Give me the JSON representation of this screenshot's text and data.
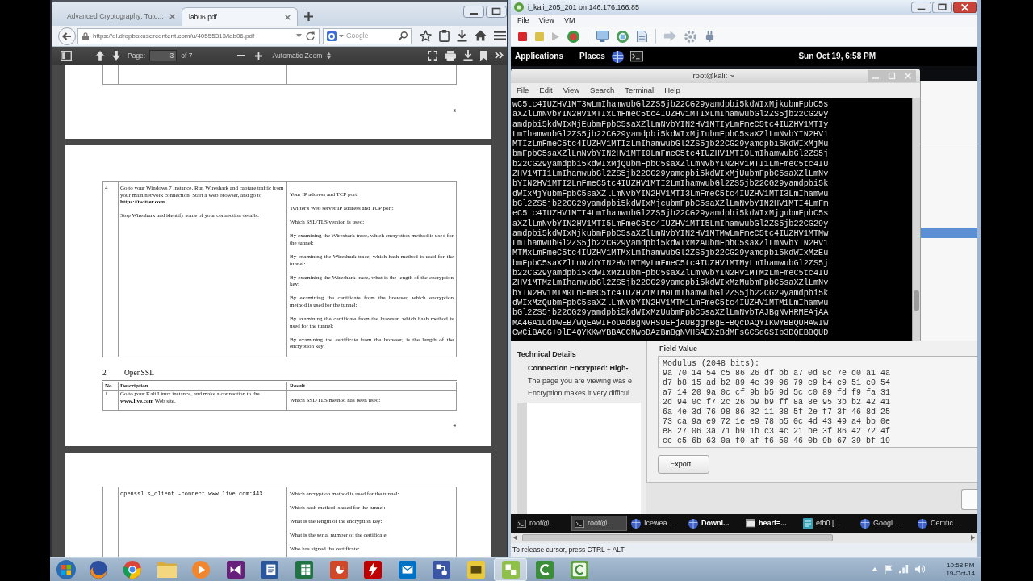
{
  "browser": {
    "tabs": [
      {
        "title": "Advanced Cryptography: Tuto...",
        "selected": false
      },
      {
        "title": "lab06.pdf",
        "selected": true
      }
    ],
    "address": "https://dl.dropboxusercontent.com/u/40555313/lab06.pdf",
    "search": {
      "placeholder": "Google"
    },
    "pdf_toolbar": {
      "page_label": "Page:",
      "page_value": "3",
      "page_total": "of 7",
      "zoom": "Automatic Zoom"
    },
    "document": {
      "page_top": {
        "page_number": "3"
      },
      "page_middle": {
        "task_table": {
          "rows": [
            {
              "number": "4",
              "description": [
                "Go to your Windows 7 instance. Run Wireshark and capture traffic from your main network connection. Start a Web browser, and go to **https://twitter.com**.",
                "Stop Wireshark and identify some of your connection details:"
              ],
              "results": [
                "Your IP address and TCP port:",
                "Twitter's Web server IP address and TCP port:",
                "Which SSL/TLS version is used:",
                "By examining the Wireshark trace, which encryption method is used for the tunnel:",
                "By examining the Wireshark trace, which hash method is used for the tunnel:",
                "By examining the Wireshark trace, what is the length of the encryption key:",
                "By examining the certificate from the browser, which encryption method is used for the tunnel:",
                "By examining the certificate from the browser, which hash method is used for the tunnel:",
                "By examining the certificate from the browser, is the length of the encryption key:"
              ]
            }
          ]
        },
        "section": {
          "number": "2",
          "title": "OpenSSL"
        },
        "openssl_table": {
          "columns": [
            "No",
            "Description",
            "Result"
          ],
          "rows": [
            {
              "number": "1",
              "description": "Go to your Kali Linux instance, and make a connection to the **www.live.com** Web site.",
              "results": [
                "Which SSL/TLS method has been used:"
              ]
            }
          ]
        },
        "page_number": "4"
      },
      "page_bottom": {
        "rows": [
          {
            "description": "openssl s_client -connect www.live.com:443",
            "results": [
              "Which encryption method is used for the tunnel:",
              "Which hash method is used for the tunnel:",
              "What is the length of the encryption key:",
              "What is the serial number of the certificate:",
              "Who has signed the certificate:"
            ]
          }
        ]
      }
    }
  },
  "vm_window": {
    "title": "i_kali_205_201 on 146.176.166.85",
    "menu": [
      "File",
      "View",
      "VM"
    ],
    "guest_panel": {
      "menus": [
        "Applications",
        "Places"
      ],
      "clock": "Sun Oct 19, 6:58 PM"
    },
    "terminal": {
      "title": "root@kali: ~",
      "menu": [
        "File",
        "Edit",
        "View",
        "Search",
        "Terminal",
        "Help"
      ],
      "lines": [
        "wC5tc4IUZHV1MT3wLmIhamwubGl2ZS5jb22CG29yamdpbi5kdWIxMjkubmFpbC5s",
        "aXZlLmNvbYIN2HV1MTIxLmFmeC5tc4IUZHV1MTIxLmIhamwubGl2ZS5jb22CG29y",
        "amdpbi5kdWIxMjEubmFpbC5saXZlLmNvbYIN2HV1MTIyLmFmeC5tc4IUZHV1MTIy",
        "LmIhamwubGl2ZS5jb22CG29yamdpbi5kdWIxMjIubmFpbC5saXZlLmNvbYIN2HV1",
        "MTIzLmFmeC5tc4IUZHV1MTIzLmIhamwubGl2ZS5jb22CG29yamdpbi5kdWIxMjMu",
        "bmFpbC5saXZlLmNvbYIN2HV1MTI0LmFmeC5tc4IUZHV1MTI0LmIhamwubGl2ZS5j",
        "b22CG29yamdpbi5kdWIxMjQubmFpbC5saXZlLmNvbYIN2HV1MTI1LmFmeC5tc4IU",
        "ZHV1MTI1LmIhamwubGl2ZS5jb22CG29yamdpbi5kdWIxMjUubmFpbC5saXZlLmNv",
        "bYIN2HV1MTI2LmFmeC5tc4IUZHV1MTI2LmIhamwubGl2ZS5jb22CG29yamdpbi5k",
        "dWIxMjYubmFpbC5saXZlLmNvbYIN2HV1MTI3LmFmeC5tc4IUZHV1MTI3LmIhamwu",
        "bGl2ZS5jb22CG29yamdpbi5kdWIxMjcubmFpbC5saXZlLmNvbYIN2HV1MTI4LmFm",
        "eC5tc4IUZHV1MTI4LmIhamwubGl2ZS5jb22CG29yamdpbi5kdWIxMjgubmFpbC5s",
        "aXZlLmNvbYIN2HV1MTI5LmFmeC5tc4IUZHV1MTI5LmIhamwubGl2ZS5jb22CG29y",
        "amdpbi5kdWIxMjkubmFpbC5saXZlLmNvbYIN2HV1MTMwLmFmeC5tc4IUZHV1MTMw",
        "LmIhamwubGl2ZS5jb22CG29yamdpbi5kdWIxMzAubmFpbC5saXZlLmNvbYIN2HV1",
        "MTMxLmFmeC5tc4IUZHV1MTMxLmIhamwubGl2ZS5jb22CG29yamdpbi5kdWIxMzEu",
        "bmFpbC5saXZlLmNvbYIN2HV1MTMyLmFmeC5tc4IUZHV1MTMyLmIhamwubGl2ZS5j",
        "b22CG29yamdpbi5kdWIxMzIubmFpbC5saXZlLmNvbYIN2HV1MTMzLmFmeC5tc4IU",
        "ZHV1MTMzLmIhamwubGl2ZS5jb22CG29yamdpbi5kdWIxMzMubmFpbC5saXZlLmNv",
        "bYIN2HV1MTM0LmFmeC5tc4IUZHV1MTM0LmIhamwubGl2ZS5jb22CG29yamdpbi5k",
        "dWIxMzQubmFpbC5saXZlLmNvbYIN2HV1MTM1LmFmeC5tc4IUZHV1MTM1LmIhamwu",
        "bGl2ZS5jb22CG29yamdpbi5kdWIxMzUubmFpbC5saXZlLmNvbTAJBgNVHRMEAjAA",
        "MA4GA1UdDwEB/wQEAwIFoDAdBgNVHSUEFjAUBggrBgEFBQcDAQYIKwYBBQUHAwIw",
        "CwCiBAGG+0lE4QYKKwYBBAGCNwoDAzBmBgNVHSAEXzBdMFsGCSqGSIb3DQEBBQUD"
      ]
    },
    "page_info": {
      "heading": "Technical Details",
      "status": "Connection Encrypted: High-",
      "lines": [
        "The page you are viewing was e",
        "Encryption makes it very difficul"
      ]
    },
    "certificate_viewer": {
      "field_value_label": "Field Value",
      "field_value_lines": [
        "Modulus (2048 bits):",
        "9a 70 14 54 c5 86 26 df bb a7 0d 8c 7e d0 a1 4a",
        "d7 b8 15 ad b2 89 4e 39 96 79 e9 b4 e9 51 e0 54",
        "a7 14 20 9a 0c cf 9b b5 9d 5c c0 89 fd f9 fa 31",
        "2d 94 0c f7 2c 26 b9 b9 ff 8a 8e 95 3b b2 42 41",
        "6a 4e 3d 76 98 86 32 11 38 5f 2e f7 3f 46 8d 25",
        "73 ca 9a e9 72 1e e9 78 b5 0c 4d 43 49 a4 bb 0e",
        "e8 27 06 3a 71 b9 1b c3 4c 21 be 3f 86 42 72 4f",
        "cc c5 6b 63 0a f0 af f6 50 46 0b 9b 67 39 bf 19"
      ],
      "export_button": "Export..."
    },
    "guest_taskbar": [
      {
        "label": "root@...",
        "kind": "terminal",
        "selected": false,
        "urgent": false
      },
      {
        "label": "root@...",
        "kind": "terminal",
        "selected": true,
        "urgent": false
      },
      {
        "label": "Icewea...",
        "kind": "browser",
        "selected": false,
        "urgent": false
      },
      {
        "label": "Downl...",
        "kind": "browser",
        "selected": false,
        "urgent": true
      },
      {
        "label": "heart=...",
        "kind": "window",
        "selected": false,
        "urgent": true
      },
      {
        "label": "eth0 [...",
        "kind": "capture",
        "selected": false,
        "urgent": false
      },
      {
        "label": "Googl...",
        "kind": "browser",
        "selected": false,
        "urgent": false
      },
      {
        "label": "Certific...",
        "kind": "browser",
        "selected": false,
        "urgent": false
      }
    ],
    "status_bar": "To release cursor, press CTRL + ALT"
  },
  "windows_taskbar": {
    "apps": [
      {
        "kind": "fox",
        "selected": false
      },
      {
        "kind": "wheel",
        "selected": false
      },
      {
        "kind": "folder",
        "selected": false
      },
      {
        "kind": "player",
        "selected": false
      },
      {
        "kind": "studio",
        "selected": false
      },
      {
        "kind": "word",
        "selected": false
      },
      {
        "kind": "sheet",
        "selected": false
      },
      {
        "kind": "slides",
        "selected": false
      },
      {
        "kind": "ftp",
        "selected": false
      },
      {
        "kind": "mail",
        "selected": false
      },
      {
        "kind": "diagram",
        "selected": false
      },
      {
        "kind": "media",
        "selected": false
      },
      {
        "kind": "vsphere",
        "selected": true
      },
      {
        "kind": "capture",
        "selected": false
      },
      {
        "kind": "editor",
        "selected": false
      }
    ],
    "clock": {
      "time": "10:58 PM",
      "date": "19-Oct-14"
    }
  }
}
